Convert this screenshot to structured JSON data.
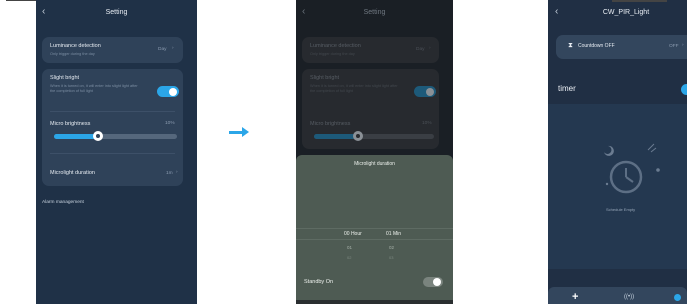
{
  "panel1": {
    "header": {
      "back": "‹",
      "title": "Setting"
    },
    "luminance": {
      "label": "Luminance detection",
      "sub": "Only trigger during the day",
      "value": "Day",
      "chevron": "›"
    },
    "slight": {
      "label": "Slight bright",
      "sub": "When it is turned on, it will enter into slight light after the completion of full light"
    },
    "micro": {
      "label": "Micro brightness",
      "value": "10%",
      "level": 0.3
    },
    "duration": {
      "label": "Microlight duration",
      "value": "1m",
      "chevron": "›"
    },
    "alarm": {
      "label": "Alarm management"
    }
  },
  "panel2": {
    "header": {
      "back": "‹",
      "title": "Setting"
    },
    "luminance": {
      "label": "Luminance detection",
      "sub": "Only trigger during the day",
      "value": "Day",
      "chevron": "›"
    },
    "slight": {
      "label": "Slight bright",
      "sub": "When it is turned on, it will enter into slight light after the completion of full light"
    },
    "micro": {
      "label": "Micro brightness",
      "value": "10%"
    },
    "sheet": {
      "title": "Microlight duration",
      "hour_selected": "00 Hour",
      "min_selected": "01 Min",
      "hour_next": "01",
      "min_next": "02",
      "hour_next2": "02",
      "min_next2": "03",
      "standby": "Standby On"
    }
  },
  "panel3": {
    "header": {
      "back": "‹",
      "title": "CW_PIR_Light"
    },
    "countdown": {
      "label": "Countdown OFF",
      "value": "OFF",
      "chevron": "›"
    },
    "timer": {
      "label": "timer"
    },
    "empty": {
      "text": "Schedule Empty"
    }
  },
  "colors": {
    "accent": "#2ba6e8",
    "card": "#2f4259",
    "bg": "#1f3147"
  }
}
